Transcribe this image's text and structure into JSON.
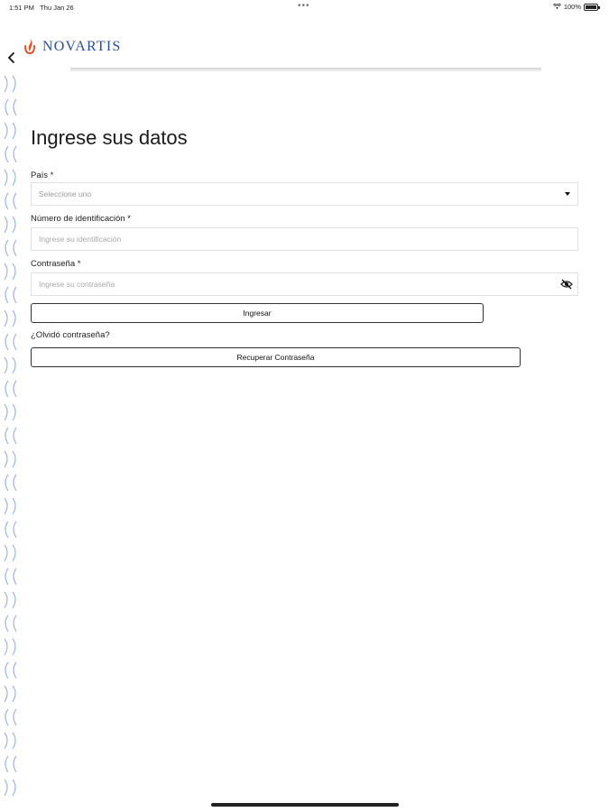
{
  "status_bar": {
    "time": "1:51 PM",
    "date": "Thu Jan 26",
    "dots": "•••",
    "battery": "100%"
  },
  "logo": {
    "text": "NOVARTIS"
  },
  "form": {
    "title": "Ingrese sus datos",
    "country_label": "País *",
    "country_value": "Seleccione uno",
    "id_label": "Número de identificación  *",
    "id_placeholder": "Ingrese su identificación",
    "password_label": "Contraseña *",
    "password_placeholder": "Ingrese su contraseña",
    "login_button": "Ingresar",
    "forgot_text": "¿Olvidó contraseña?",
    "recover_button": "Recuperar Contraseña"
  },
  "colors": {
    "brand_blue": "#2a4f9a",
    "logo_flame": "#e2542a",
    "side_pattern": "#9bb6dd"
  }
}
